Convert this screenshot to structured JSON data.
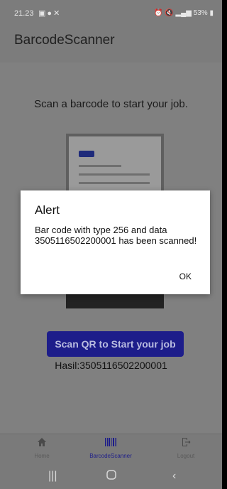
{
  "status_bar": {
    "time": "21.23",
    "left_icons": [
      "gallery-icon",
      "message-icon",
      "x-icon"
    ],
    "right_text": "53%",
    "right_icons": [
      "alarm-icon",
      "mute-icon",
      "signal-icon",
      "battery-icon"
    ]
  },
  "app": {
    "title": "BarcodeScanner"
  },
  "main": {
    "prompt": "Scan a barcode to start your job.",
    "scan_button_label": "Scan QR to Start your job",
    "result_text": "Hasil:3505116502200001"
  },
  "dialog": {
    "title": "Alert",
    "message": "Bar code with type 256 and data 3505116502200001 has been scanned!",
    "ok_label": "OK"
  },
  "bottom_nav": [
    {
      "label": "Home",
      "icon": "home-icon",
      "active": false
    },
    {
      "label": "BarcodeScanner",
      "icon": "barcode-icon",
      "active": true
    },
    {
      "label": "Logout",
      "icon": "logout-icon",
      "active": false
    }
  ],
  "system_nav": [
    "recents-icon",
    "home-circle-icon",
    "back-icon"
  ],
  "colors": {
    "accent": "#1d1d8a",
    "scrim": "#808080",
    "dialog_bg": "#ffffff"
  }
}
